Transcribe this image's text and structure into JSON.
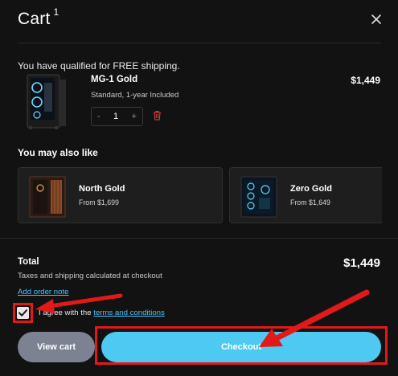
{
  "header": {
    "title": "Cart",
    "count": "1",
    "close_icon": "close-icon"
  },
  "shipping_message": "You have qualified for FREE shipping.",
  "cart_item": {
    "name": "MG-1 Gold",
    "price": "$1,449",
    "variant": "Standard, 1-year Included",
    "quantity": "1",
    "minus": "-",
    "plus": "+"
  },
  "recommendations": {
    "heading": "You may also like",
    "items": [
      {
        "name": "North Gold",
        "price": "From $1,699"
      },
      {
        "name": "Zero Gold",
        "price": "From $1,649"
      }
    ]
  },
  "summary": {
    "total_label": "Total",
    "total_value": "$1,449",
    "tax_note": "Taxes and shipping calculated at checkout",
    "order_note": "Add order note"
  },
  "agreement": {
    "text": "I agree with the",
    "link": "terms and conditions",
    "checked": true
  },
  "actions": {
    "view_cart": "View cart",
    "checkout": "Checkout"
  },
  "colors": {
    "background": "#121212",
    "accent": "#4dc9f2",
    "link": "#4fc3f7",
    "secondary_button": "#7d8292",
    "annotation": "#e11919"
  }
}
